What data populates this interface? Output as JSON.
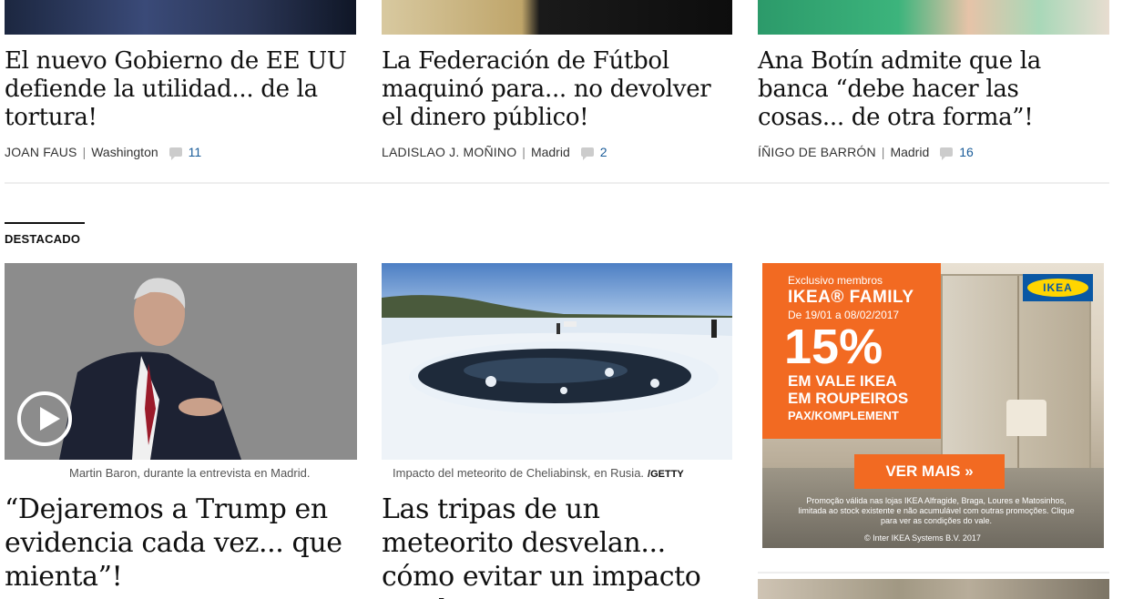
{
  "top_articles": [
    {
      "headline": "El nuevo Gobierno de EE UU defiende la utilidad... de la tortura!",
      "author": "JOAN FAUS",
      "location": "Washington",
      "comments": "11"
    },
    {
      "headline": "La Federación de Fútbol maquinó para... no devolver el dinero público!",
      "author": "LADISLAO J. MOÑINO",
      "location": "Madrid",
      "comments": "2"
    },
    {
      "headline": "Ana Botín admite que la banca “debe hacer las cosas... de otra forma”!",
      "author": "ÍÑIGO DE BARRÓN",
      "location": "Madrid",
      "comments": "16"
    }
  ],
  "section": {
    "title": "DESTACADO"
  },
  "featured": [
    {
      "caption": "Martin Baron, durante la entrevista en Madrid.",
      "headline": "“Dejaremos a Trump en evidencia cada vez... que mienta”!"
    },
    {
      "caption": "Impacto del meteorito de Cheliabinsk, en Rusia.",
      "credit": "/GETTY",
      "headline": "Las tripas de un meteorito desvelan... cómo evitar un impacto con la Tierra!"
    }
  ],
  "ad": {
    "members": "Exclusivo membros",
    "family": "IKEA® FAMILY",
    "dates": "De 19/01 a 08/02/2017",
    "percent": "15%",
    "vale_line1": "EM VALE IKEA",
    "vale_line2": "EM ROUPEIROS",
    "pax": "PAX/KOMPLEMENT",
    "logo": "IKEA",
    "cta": "VER MAIS »",
    "legal": "Promoção válida nas lojas IKEA Alfragide, Braga, Loures e Matosinhos, limitada ao stock existente e não acumulável com outras promoções. Clique para ver as condições do vale.",
    "copyright": "© Inter IKEA Systems B.V. 2017"
  },
  "colors": {
    "comment_count": "#1a5c99",
    "ikea_orange": "#f26a22",
    "ikea_blue": "#0a58a4",
    "ikea_yellow": "#ffd500"
  }
}
